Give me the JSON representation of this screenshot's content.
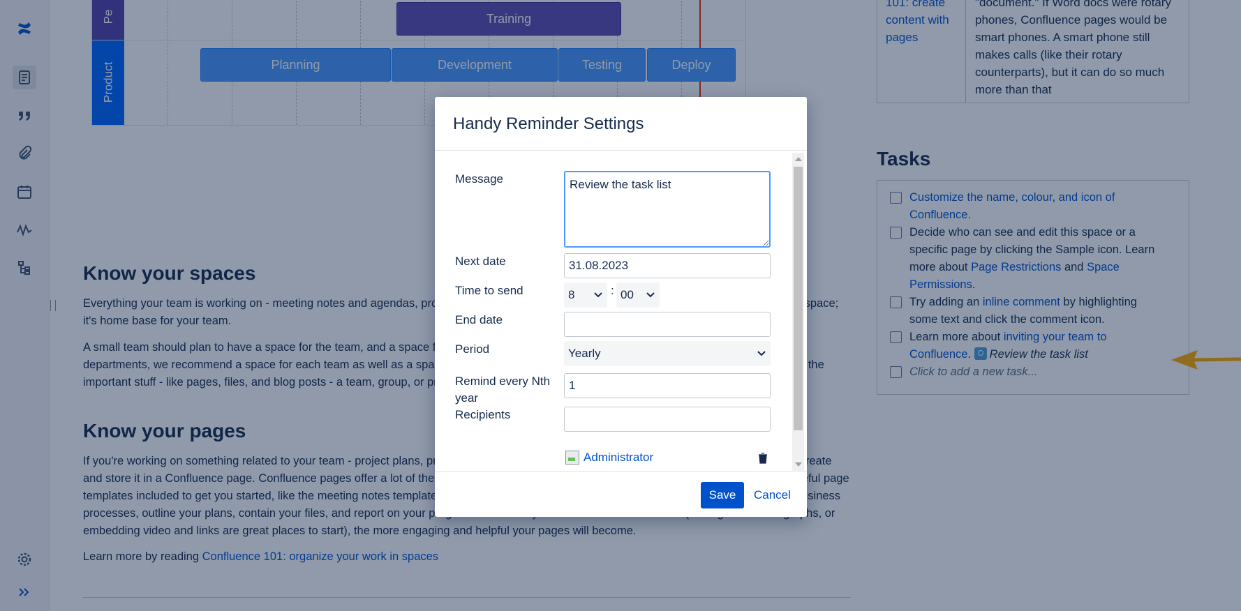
{
  "roadmap": {
    "lanes": [
      "Pe",
      "Product"
    ],
    "bars": [
      "Training",
      "Planning",
      "Development",
      "Testing",
      "Deploy"
    ]
  },
  "spaces": {
    "title": "Know your spaces",
    "p1": "Everything your team is working on - meeting notes and agendas, project plans, timelines, technical documentation and more - is located in a space; it's home base for your team.",
    "p2": "A small team should plan to have a space for the team, and a space for their projects. For larger organizations with many other teams and departments, we recommend a space for each team as well as a space for each major project. Think of a space as the container that holds all the important stuff - like pages, files, and blog posts - a team, group, or project needs to work."
  },
  "pages": {
    "title": "Know your pages",
    "p1": "If you're working on something related to your team - project plans, product requirements, meeting notes, planning documents, you name it - create and store it in a Confluence page. Confluence pages offer a lot of the same features as other document editors, and there are a number of useful page templates included to get you started, like the meeting notes template and the product requirements template. Use pages to document your business processes, outline your plans, contain your files, and report on your progress. The more you learn to do in Confluence (adding tables and graphs, or embedding video and links are great places to start), the more engaging and helpful your pages will become.",
    "learn_prefix": "Learn more by reading ",
    "learn_link": "Confluence 101: organize your work in spaces"
  },
  "right_table": {
    "left_text": "101: create content with pages",
    "right_text": "\"document.\" If Word docs were rotary phones, Confluence pages would be smart phones. A smart phone still makes calls (like their rotary counterparts), but it can do so much more than that"
  },
  "tasks": {
    "title": "Tasks",
    "t1_link": "Customize the name, colour, and icon of Confluence.",
    "t2_pre": "Decide who can see and edit this space or a specific page by clicking the Sample icon. Learn more about ",
    "t2_link1": "Page Restrictions",
    "t2_mid": " and ",
    "t2_link2": "Space Permissions",
    "t2_end": ".",
    "t3_pre": "Try adding an ",
    "t3_link": "inline comment",
    "t3_post": " by highlighting some text and click the comment icon.",
    "t4_pre": "Learn more about ",
    "t4_link": "inviting your team to Confluence",
    "t4_end": ".",
    "t4_reminder": "Review the task list",
    "t5_placeholder": "Click to add a new task..."
  },
  "modal": {
    "title": "Handy Reminder Settings",
    "message_label": "Message",
    "message_value": "Review the task list",
    "next_date_label": "Next date",
    "next_date_value": "31.08.2023",
    "time_label": "Time to send",
    "hour": "8",
    "minute": "00",
    "end_date_label": "End date",
    "end_date_value": "",
    "period_label": "Period",
    "period_value": "Yearly",
    "remind_label": "Remind every Nth year",
    "remind_value": "1",
    "recipients_label": "Recipients",
    "recipients_value": "",
    "recipient_name": "Administrator",
    "save": "Save",
    "cancel": "Cancel"
  },
  "colors": {
    "primary": "#0052cc",
    "bar_training": "#5e4db2",
    "bar_product": "#4c9aff",
    "lane_pe": "#5243aa",
    "lane_product": "#0065ff",
    "arrow": "#ffab00"
  },
  "icons": [
    "confluence-logo-icon",
    "page-icon",
    "quote-icon",
    "attachment-icon",
    "calendar-icon",
    "analytics-icon",
    "hierarchy-icon",
    "settings-icon",
    "expand-icon",
    "trash-icon",
    "chevron-down-icon"
  ]
}
